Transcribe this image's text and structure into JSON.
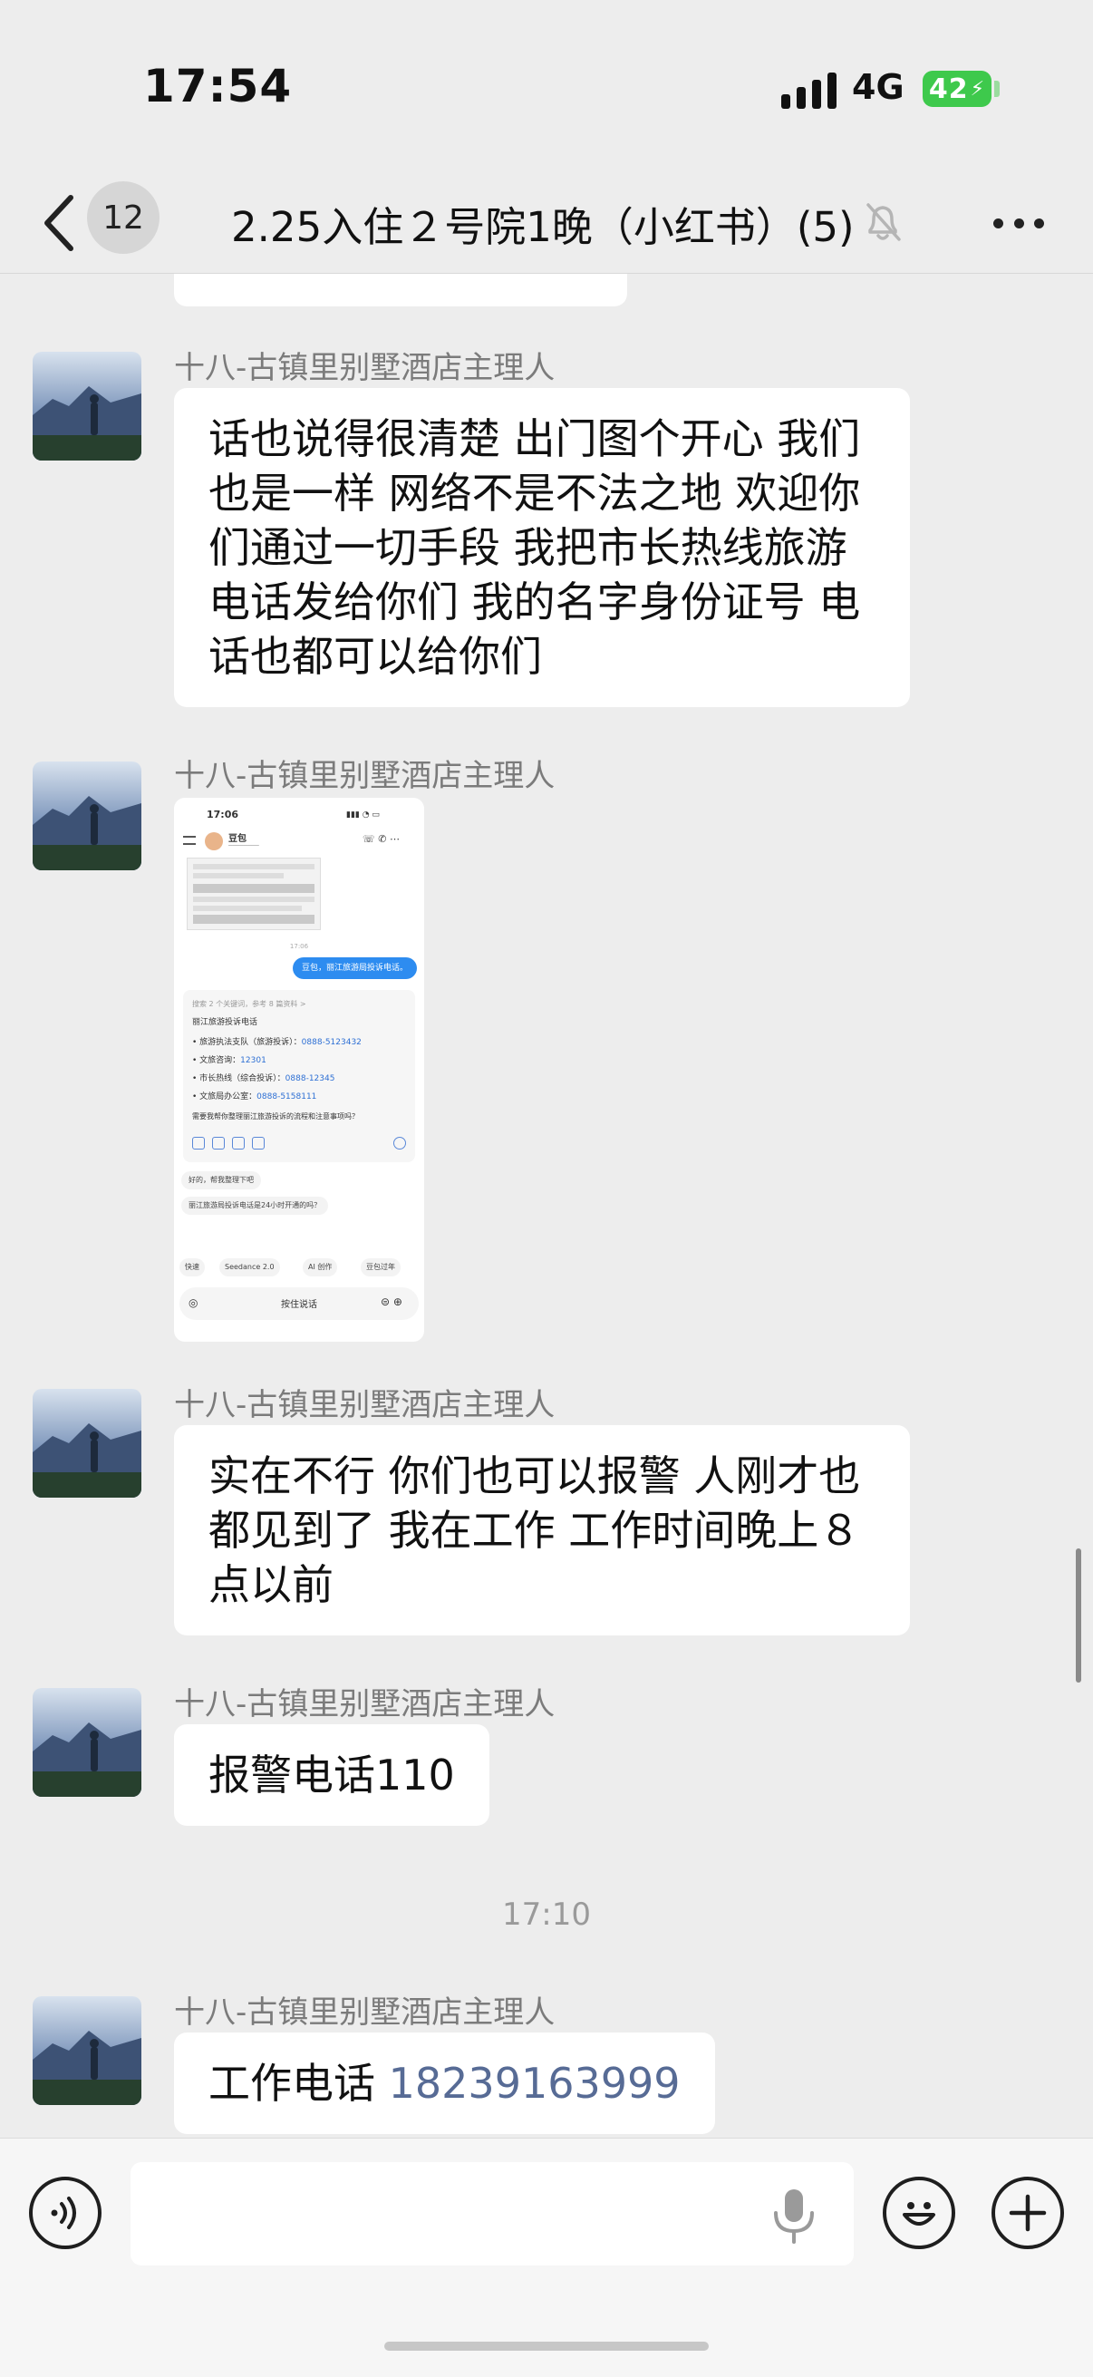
{
  "status_bar": {
    "time": "17:54",
    "network": "4G",
    "battery": "42"
  },
  "nav": {
    "unread_count": "12",
    "title": "2.25入住２号院1晚（小红书）(5)"
  },
  "messages": [
    {
      "sender": "十八-古镇里别墅酒店主理人",
      "text": "话也说得很清楚 出门图个开心 我们也是一样 网络不是不法之地 欢迎你们通过一切手段 我把市长热线旅游电话发给你们 我的名字身份证号 电话也都可以给你们"
    },
    {
      "sender": "十八-古镇里别墅酒店主理人",
      "image": {
        "time": "17:06",
        "contact_name": "豆包",
        "timestamp": "17:06",
        "user_message": "豆包，丽江旅游局投诉电话。",
        "search_meta": "搜索 2 个关键词，参考 8 篇资料 >",
        "answer_title": "丽江旅游投诉电话",
        "items": [
          {
            "label": "• 旅游执法支队（旅游投诉）：",
            "value": "0888-5123432"
          },
          {
            "label": "• 文旅咨询：",
            "value": "12301"
          },
          {
            "label": "• 市长热线（综合投诉）：",
            "value": "0888-12345"
          },
          {
            "label": "• 文旅局办公室：",
            "value": "0888-5158111"
          }
        ],
        "follow_up": "需要我帮你整理丽江旅游投诉的流程和注意事项吗？",
        "chip_1": "好的，帮我整理下吧",
        "chip_2": "丽江旅游局投诉电话是24小时开通的吗？",
        "tools": [
          "快速",
          "Seedance 2.0",
          "AI 创作",
          "豆包过年"
        ],
        "input_hint": "按住说话"
      }
    },
    {
      "sender": "十八-古镇里别墅酒店主理人",
      "text": "实在不行 你们也可以报警 人刚才也都见到了 我在工作 工作时间晚上８点以前"
    },
    {
      "sender": "十八-古镇里别墅酒店主理人",
      "text": "报警电话110"
    },
    {
      "time_separator": "17:10"
    },
    {
      "sender": "十八-古镇里别墅酒店主理人",
      "text_prefix": "工作电话 ",
      "phone": "18239163999"
    }
  ],
  "colors": {
    "background": "#ededed",
    "bubble": "#ffffff",
    "link": "#576b95",
    "battery": "#3ec94c"
  },
  "icons": [
    "back-chevron-icon",
    "mute-bell-icon",
    "more-icon",
    "voice-icon",
    "microphone-icon",
    "emoji-icon",
    "plus-icon"
  ]
}
